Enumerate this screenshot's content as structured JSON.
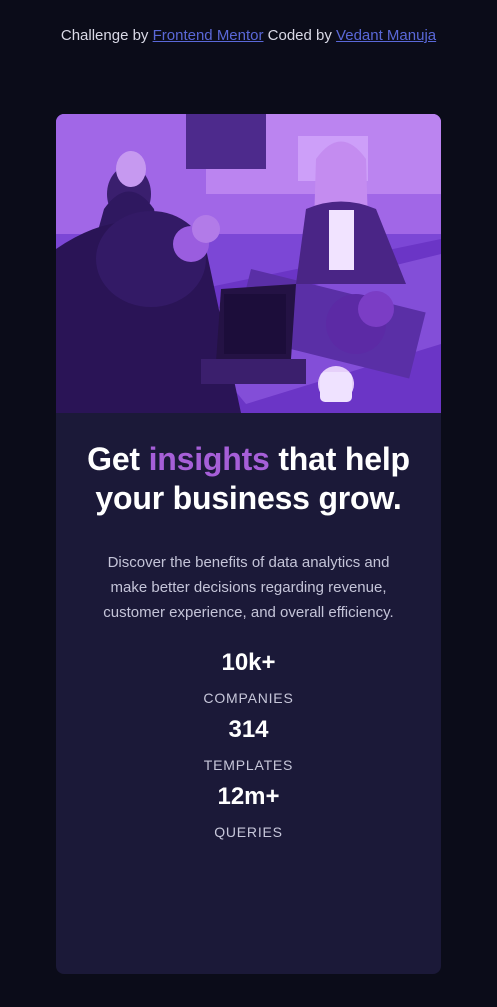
{
  "attribution": {
    "prefix": "Challenge by ",
    "author_link": "Frontend Mentor",
    "middle": " Coded by ",
    "coder_link": "Vedant Manuja"
  },
  "card": {
    "headline": {
      "part1": "Get ",
      "accent": "insights",
      "part2": " that help your business grow."
    },
    "description": "Discover the benefits of data analytics and make better decisions regarding revenue, customer experience, and overall efficiency.",
    "stats": [
      {
        "value": "10k+",
        "label": "COMPANIES"
      },
      {
        "value": "314",
        "label": "TEMPLATES"
      },
      {
        "value": "12m+",
        "label": "QUERIES"
      }
    ]
  },
  "colors": {
    "background": "#0b0c19",
    "card": "#1b1938",
    "accent": "#a65fd8",
    "link": "#5a68d8"
  }
}
